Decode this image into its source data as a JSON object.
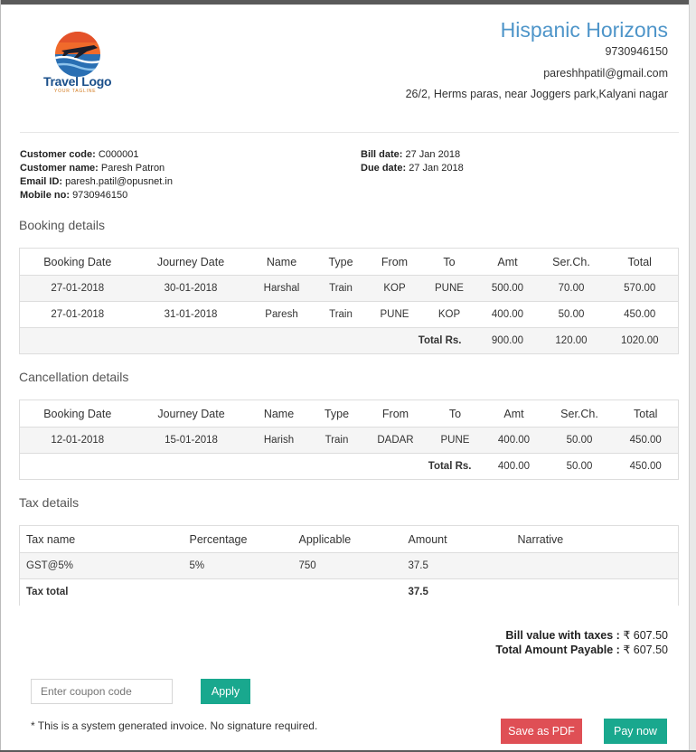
{
  "company": {
    "name": "Hispanic Horizons",
    "phone": "9730946150",
    "email": "pareshhpatil@gmail.com",
    "address": "26/2, Herms paras, near Joggers park,Kalyani nagar",
    "logo_text": "Travel Logo",
    "logo_tagline": "YOUR TAGLINE"
  },
  "customer": {
    "code_label": "Customer code:",
    "code": "C000001",
    "name_label": "Customer name:",
    "name": "Paresh Patron",
    "email_label": "Email ID:",
    "email": "paresh.patil@opusnet.in",
    "mobile_label": "Mobile no:",
    "mobile": "9730946150"
  },
  "bill": {
    "bill_date_label": "Bill date:",
    "bill_date": "27 Jan 2018",
    "due_date_label": "Due date:",
    "due_date": "27 Jan 2018"
  },
  "booking": {
    "title": "Booking details",
    "headers": [
      "Booking Date",
      "Journey Date",
      "Name",
      "Type",
      "From",
      "To",
      "Amt",
      "Ser.Ch.",
      "Total"
    ],
    "rows": [
      [
        "27-01-2018",
        "30-01-2018",
        "Harshal",
        "Train",
        "KOP",
        "PUNE",
        "500.00",
        "70.00",
        "570.00"
      ],
      [
        "27-01-2018",
        "31-01-2018",
        "Paresh",
        "Train",
        "PUNE",
        "KOP",
        "400.00",
        "50.00",
        "450.00"
      ]
    ],
    "total_label": "Total Rs.",
    "totals": [
      "900.00",
      "120.00",
      "1020.00"
    ]
  },
  "cancellation": {
    "title": "Cancellation details",
    "headers": [
      "Booking Date",
      "Journey Date",
      "Name",
      "Type",
      "From",
      "To",
      "Amt",
      "Ser.Ch.",
      "Total"
    ],
    "rows": [
      [
        "12-01-2018",
        "15-01-2018",
        "Harish",
        "Train",
        "DADAR",
        "PUNE",
        "400.00",
        "50.00",
        "450.00"
      ]
    ],
    "total_label": "Total Rs.",
    "totals": [
      "400.00",
      "50.00",
      "450.00"
    ]
  },
  "tax": {
    "title": "Tax details",
    "headers": [
      "Tax name",
      "Percentage",
      "Applicable",
      "Amount",
      "Narrative"
    ],
    "rows": [
      [
        "GST@5%",
        "5%",
        "750",
        "37.5",
        ""
      ]
    ],
    "total_label": "Tax total",
    "total_amount": "37.5"
  },
  "summary": {
    "bill_value_label": "Bill value with taxes :",
    "bill_value": "₹ 607.50",
    "payable_label": "Total Amount Payable :",
    "payable": "₹ 607.50"
  },
  "actions": {
    "coupon_placeholder": "Enter coupon code",
    "apply_label": "Apply",
    "note": "* This is a system generated invoice. No signature required.",
    "pdf_label": "Save as PDF",
    "pay_label": "Pay now"
  },
  "colors": {
    "brand": "#4e95c9",
    "accent": "#19a88e",
    "danger": "#df4f55"
  }
}
